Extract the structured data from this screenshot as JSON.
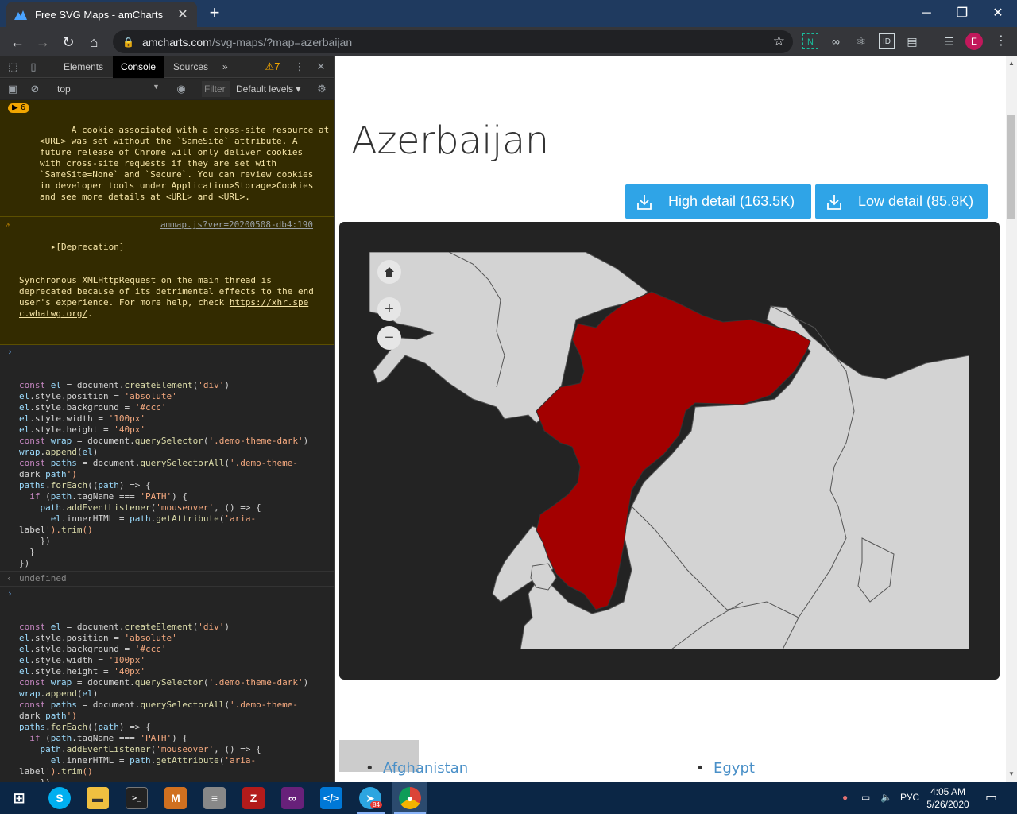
{
  "browser": {
    "tab_title": "Free SVG Maps - amCharts",
    "tab_close": "✕",
    "new_tab": "+",
    "window": {
      "minimize": "─",
      "restore": "❐",
      "close": "✕"
    },
    "url_host": "amcharts.com",
    "url_path": "/svg-maps/?map=azerbaijan",
    "profile_initial": "E"
  },
  "devtools": {
    "tabs": [
      "Elements",
      "Console",
      "Sources",
      "»"
    ],
    "warning_count": "7",
    "context": "top",
    "filter_placeholder": "Filter",
    "levels": "Default levels ▾",
    "messages": {
      "cookie_badge": "6",
      "cookie_text": "A cookie associated with a cross-site resource at\n<URL> was set without the `SameSite` attribute. A\nfuture release of Chrome will only deliver cookies\nwith cross-site requests if they are set with\n`SameSite=None` and `Secure`. You can review cookies\nin developer tools under Application>Storage>Cookies\nand see more details at <URL> and <URL>.",
      "deprecation_title": "▸[Deprecation]",
      "deprecation_source": "ammap.js?ver=20200508-db4:190",
      "deprecation_text": "Synchronous XMLHttpRequest on the main thread is\ndeprecated because of its detrimental effects to the end\nuser's experience. For more help, check ",
      "deprecation_link": "https://xhr.spe\nc.whatwg.org/",
      "deprecation_end": ".",
      "code_lines": [
        "const el = document.createElement('div')",
        "el.style.position = 'absolute'",
        "el.style.background = '#ccc'",
        "el.style.width = '100px'",
        "el.style.height = '40px'",
        "const wrap = document.querySelector('.demo-theme-dark')",
        "wrap.append(el)",
        "const paths = document.querySelectorAll('.demo-theme-",
        "dark path')",
        "paths.forEach((path) => {",
        "  if (path.tagName === 'PATH') {",
        "    path.addEventListener('mouseover', () => {",
        "      el.innerHTML = path.getAttribute('aria-",
        "label').trim()",
        "    })",
        "  }",
        "})"
      ],
      "result": "undefined"
    }
  },
  "page": {
    "title": "Azerbaijan",
    "high_detail": "High detail (163.5K)",
    "low_detail": "Low detail (85.8K)",
    "zoom_plus": "+",
    "zoom_minus": "−",
    "list_items": [
      "Afghanistan",
      "Egypt"
    ]
  },
  "taskbar": {
    "lang": "РУС",
    "time": "4:05 AM",
    "date": "5/26/2020",
    "telegram_badge": "84"
  },
  "colors": {
    "highlight_region": "#a30000",
    "neighbors": "#d3d3d3",
    "map_bg": "#232323",
    "button": "#2fa4e7"
  }
}
